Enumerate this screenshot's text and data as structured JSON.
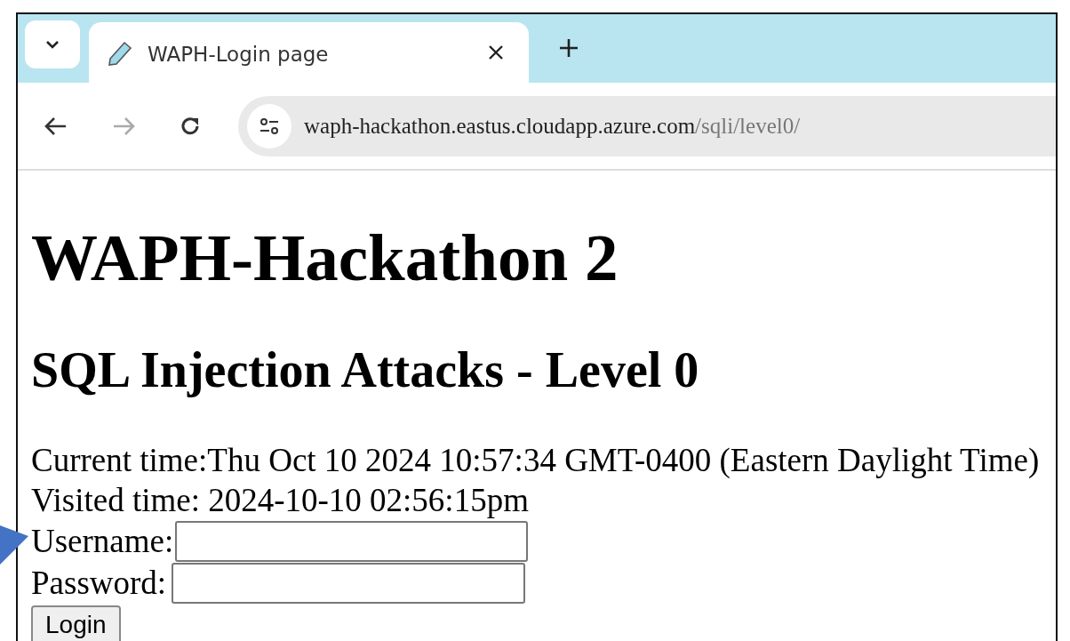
{
  "browser": {
    "tab": {
      "title": "WAPH-Login page",
      "selected": true
    },
    "address": {
      "host": "waph-hackathon.eastus.cloudapp.azure.com",
      "path": "/sqli/level0/"
    }
  },
  "page": {
    "heading": "WAPH-Hackathon 2",
    "subheading": "SQL Injection Attacks - Level 0",
    "lines": [
      "Current time:Thu Oct 10 2024 10:57:34 GMT-0400 (Eastern Daylight Time)",
      "Visited time: 2024-10-10 02:56:15pm"
    ],
    "form": {
      "fields": [
        {
          "label": "Username:",
          "kind": "text"
        },
        {
          "label": "Password:",
          "kind": "password"
        }
      ],
      "button": "Login"
    }
  }
}
